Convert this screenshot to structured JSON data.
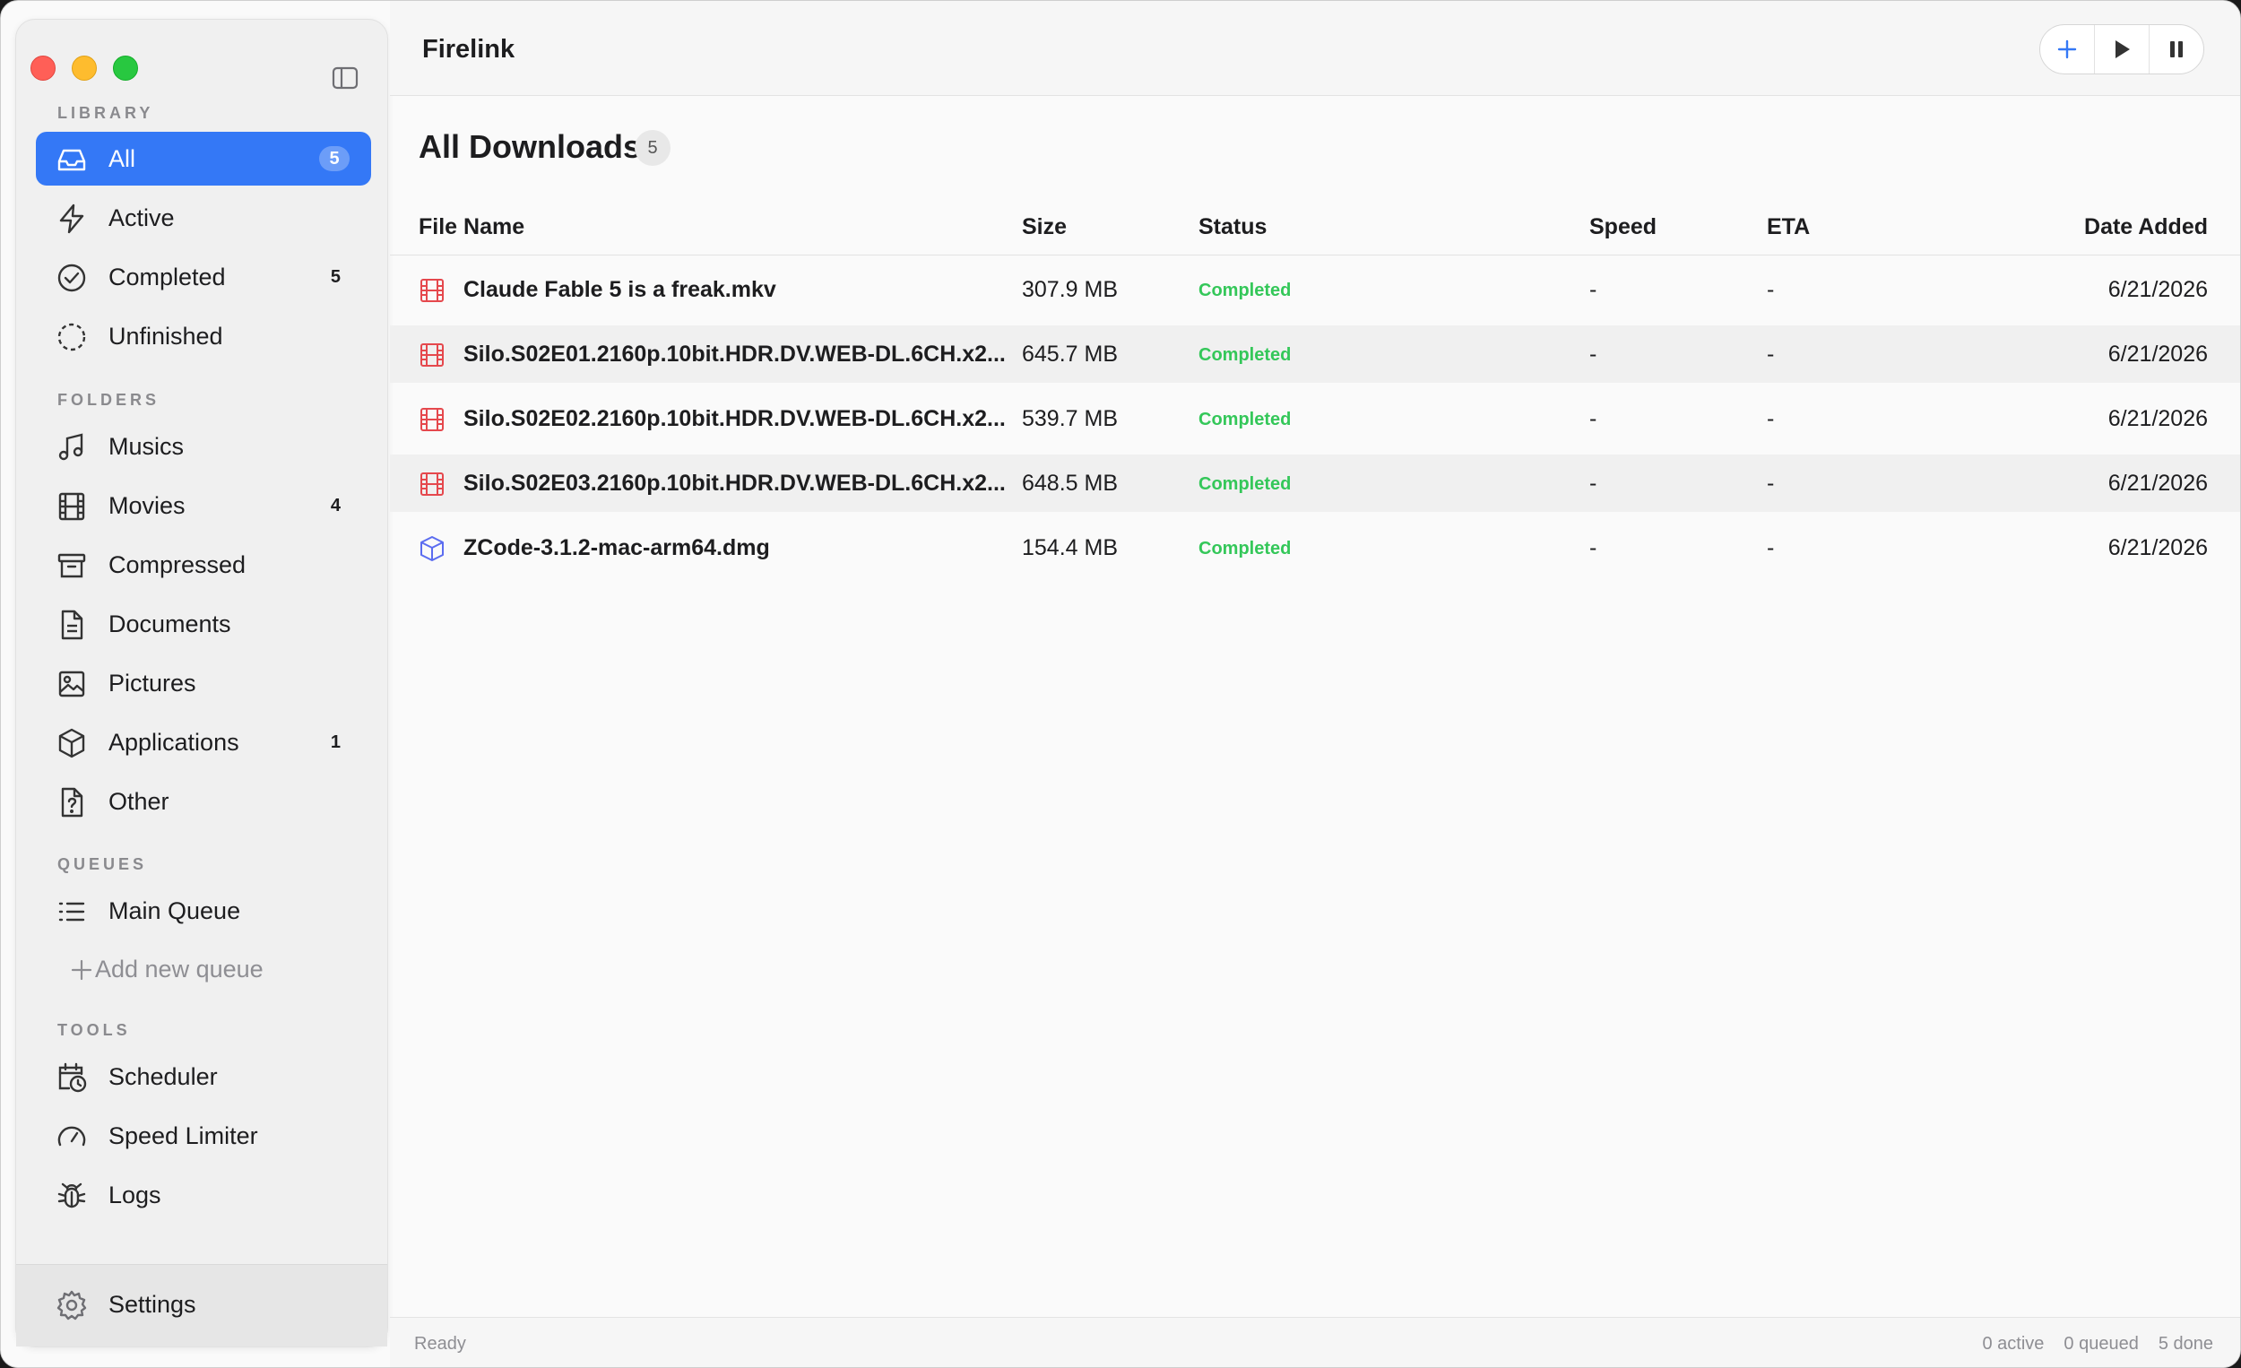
{
  "app": {
    "title": "Firelink"
  },
  "sidebar": {
    "sections": {
      "library": "LIBRARY",
      "folders": "FOLDERS",
      "queues": "QUEUES",
      "tools": "TOOLS"
    },
    "library": [
      {
        "label": "All",
        "count": "5",
        "icon": "inbox-icon",
        "active": true
      },
      {
        "label": "Active",
        "count": "",
        "icon": "lightning-icon"
      },
      {
        "label": "Completed",
        "count": "5",
        "icon": "check-circle-icon"
      },
      {
        "label": "Unfinished",
        "count": "",
        "icon": "dashed-circle-icon"
      }
    ],
    "folders": [
      {
        "label": "Musics",
        "count": "",
        "icon": "music-note-icon"
      },
      {
        "label": "Movies",
        "count": "4",
        "icon": "film-icon"
      },
      {
        "label": "Compressed",
        "count": "",
        "icon": "archive-box-icon"
      },
      {
        "label": "Documents",
        "count": "",
        "icon": "document-icon"
      },
      {
        "label": "Pictures",
        "count": "",
        "icon": "picture-icon"
      },
      {
        "label": "Applications",
        "count": "1",
        "icon": "cube-icon"
      },
      {
        "label": "Other",
        "count": "",
        "icon": "question-file-icon"
      }
    ],
    "queues": [
      {
        "label": "Main Queue",
        "icon": "list-icon"
      }
    ],
    "add_queue_label": "Add new queue",
    "tools": [
      {
        "label": "Scheduler",
        "icon": "calendar-clock-icon"
      },
      {
        "label": "Speed Limiter",
        "icon": "gauge-icon"
      },
      {
        "label": "Logs",
        "icon": "bug-icon"
      }
    ],
    "settings_label": "Settings"
  },
  "main": {
    "title": "All Downloads",
    "count": "5",
    "columns": {
      "name": "File Name",
      "size": "Size",
      "status": "Status",
      "speed": "Speed",
      "eta": "ETA",
      "date": "Date Added"
    },
    "rows": [
      {
        "name": "Claude Fable 5 is a freak.mkv",
        "size": "307.9 MB",
        "status": "Completed",
        "speed": "-",
        "eta": "-",
        "date": "6/21/2026",
        "icon": "film-icon"
      },
      {
        "name": "Silo.S02E01.2160p.10bit.HDR.DV.WEB-DL.6CH.x2...",
        "size": "645.7 MB",
        "status": "Completed",
        "speed": "-",
        "eta": "-",
        "date": "6/21/2026",
        "icon": "film-icon"
      },
      {
        "name": "Silo.S02E02.2160p.10bit.HDR.DV.WEB-DL.6CH.x2...",
        "size": "539.7 MB",
        "status": "Completed",
        "speed": "-",
        "eta": "-",
        "date": "6/21/2026",
        "icon": "film-icon"
      },
      {
        "name": "Silo.S02E03.2160p.10bit.HDR.DV.WEB-DL.6CH.x2...",
        "size": "648.5 MB",
        "status": "Completed",
        "speed": "-",
        "eta": "-",
        "date": "6/21/2026",
        "icon": "film-icon"
      },
      {
        "name": "ZCode-3.1.2-mac-arm64.dmg",
        "size": "154.4 MB",
        "status": "Completed",
        "speed": "-",
        "eta": "-",
        "date": "6/21/2026",
        "icon": "cube-icon"
      }
    ]
  },
  "statusbar": {
    "left": "Ready",
    "active": "0 active",
    "queued": "0 queued",
    "done": "5 done"
  },
  "colors": {
    "accent": "#3478f6",
    "status_completed": "#34c759",
    "film_icon": "#e5484d",
    "app_icon": "#5b6cf0"
  }
}
